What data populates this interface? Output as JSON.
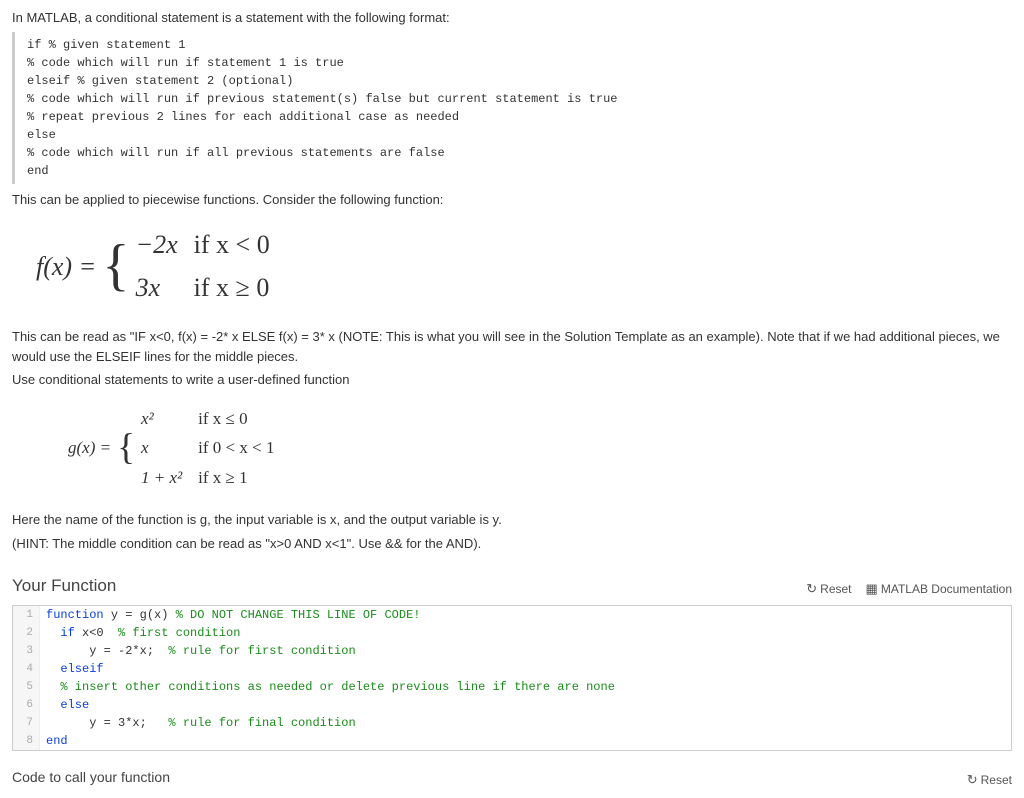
{
  "intro": "In MATLAB, a conditional statement is a statement with the following format:",
  "code1": [
    "if % given statement 1",
    "% code which will run if statement 1 is true",
    "elseif % given statement 2 (optional)",
    "% code which will run if previous statement(s) false but current statement is true",
    "% repeat previous 2 lines for each additional case as needed",
    "else",
    "% code which will run if all previous statements are false",
    "end"
  ],
  "p2": "This can be applied to piecewise functions. Consider the following function:",
  "eq_f": {
    "lhs": "f(x) =",
    "rows": [
      {
        "expr": "−2x",
        "cond": "if x < 0"
      },
      {
        "expr": "3x",
        "cond": "if x ≥ 0"
      }
    ]
  },
  "p3": "This can be read as \"IF x<0, f(x) = -2* x ELSE f(x) = 3* x (NOTE: This is what you will see in the Solution Template as an example). Note that if we had additional pieces, we would use the ELSEIF lines for the middle pieces.",
  "p4": "Use conditional statements to write a user-defined function",
  "eq_g": {
    "lhs": "g(x) =",
    "rows": [
      {
        "expr": "x²",
        "cond": "if x ≤ 0"
      },
      {
        "expr": "x",
        "cond": "if 0 < x < 1"
      },
      {
        "expr": "1 + x²",
        "cond": "if x ≥ 1"
      }
    ]
  },
  "p5": "Here the name of the function is g, the input variable is x, and the output variable is y.",
  "p6": "(HINT: The middle condition can be read as \"x>0 AND x<1\". Use && for the AND).",
  "yourFunction": {
    "title": "Your Function",
    "reset": "Reset",
    "docs": "MATLAB Documentation"
  },
  "editor": [
    {
      "n": "1",
      "kw": "function ",
      "txt": "y = g(x) ",
      "com": "% DO NOT CHANGE THIS LINE OF CODE!"
    },
    {
      "n": "2",
      "indent": "  ",
      "kw": "if ",
      "txt": "x<0  ",
      "com": "% first condition"
    },
    {
      "n": "3",
      "indent": "      ",
      "txt": "y = -2*x;  ",
      "com": "% rule for first condition"
    },
    {
      "n": "4",
      "indent": "  ",
      "kw": "elseif",
      "txt": "",
      "com": ""
    },
    {
      "n": "5",
      "indent": "  ",
      "com": "% insert other conditions as needed or delete previous line if there are none"
    },
    {
      "n": "6",
      "indent": "  ",
      "kw": "else",
      "txt": "",
      "com": ""
    },
    {
      "n": "7",
      "indent": "      ",
      "txt": "y = 3*x;   ",
      "com": "% rule for final condition"
    },
    {
      "n": "8",
      "kw": "end",
      "txt": "",
      "com": ""
    }
  ],
  "codeCall": {
    "title": "Code to call your function",
    "reset": "Reset"
  }
}
